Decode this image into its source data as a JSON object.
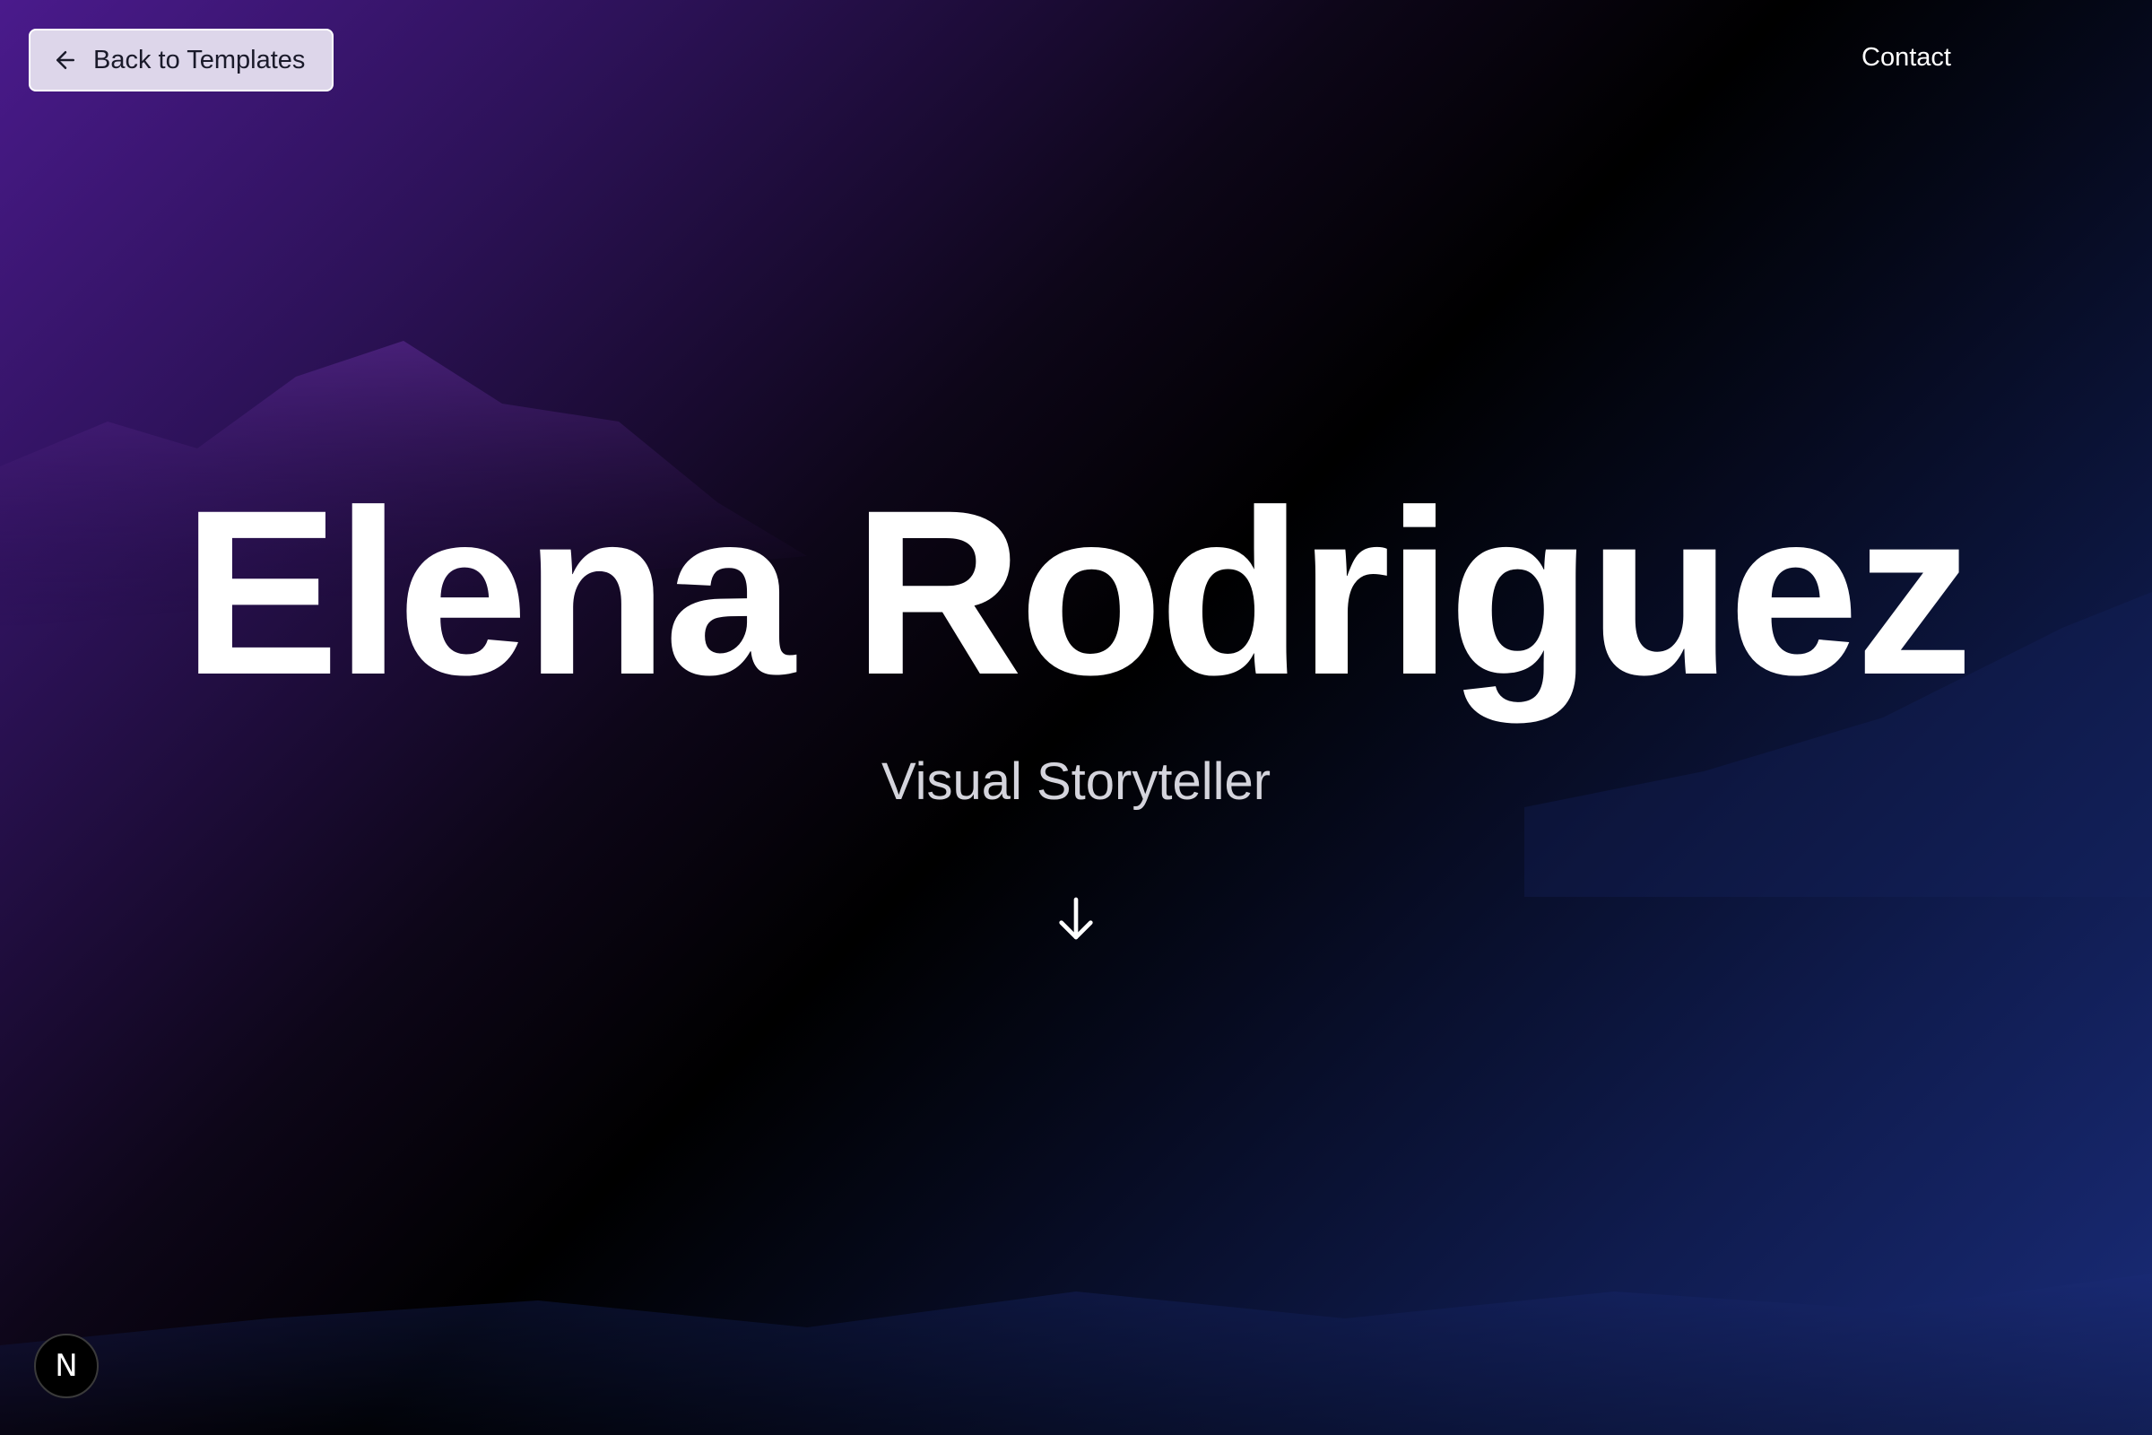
{
  "header": {
    "back_label": "Back to Templates",
    "back_icon": "arrow-left-icon",
    "contact_label": "Contact"
  },
  "hero": {
    "name": "Elena Rodriguez",
    "subtitle": "Visual Storyteller",
    "scroll_icon": "arrow-down-icon"
  },
  "badge": {
    "letter": "N"
  },
  "colors": {
    "purple": "#4a1a8c",
    "blue": "#1a2c7a",
    "button_bg": "#ddd6ea",
    "text": "#ffffff"
  }
}
